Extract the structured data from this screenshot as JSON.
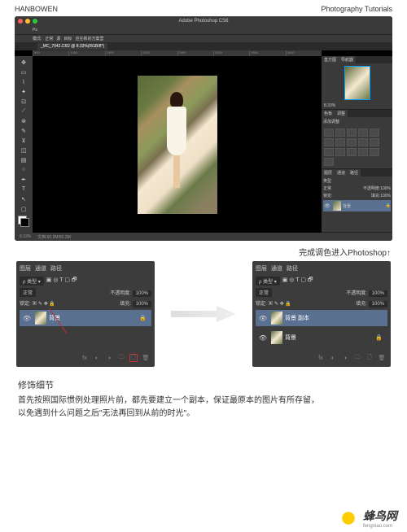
{
  "header": {
    "left": "HANBOWEN",
    "right": "Photography Tutorials"
  },
  "app": {
    "title": "Adobe Photoshop CS6"
  },
  "menubar": [
    "模式:",
    "正常",
    "源",
    "▼",
    "目标",
    "▼",
    "应在新的方案里",
    "☐"
  ],
  "tab": "_MC_7042.CR2 @ 8.33%(RGB/8*)",
  "ruler": [
    "500",
    "1000",
    "1500",
    "2000",
    "2500",
    "3000",
    "3500",
    "4000"
  ],
  "nav": {
    "tabs": [
      "直方图",
      "导航器"
    ],
    "zoom": "8.33%"
  },
  "adj": {
    "tabs": [
      "色板",
      "调整"
    ],
    "title": "添加调整"
  },
  "layers": {
    "tabs": [
      "图层",
      "通道",
      "路径"
    ],
    "kind": "类型",
    "blend": "正常",
    "opacity": "不透明度:",
    "opval": "100%",
    "lock": "锁定:",
    "fill": "填充:",
    "fillval": "100%",
    "layer": "背景"
  },
  "status": {
    "zoom": "8.33%",
    "doc": "文档:60.2M/60.2M"
  },
  "caption1": "完成调色进入Photoshop↑",
  "panelL": {
    "tabs": [
      "图层",
      "通道",
      "路径"
    ],
    "kind": "类型",
    "blend": "正常",
    "opacity": "不透明度:",
    "opval": "100%",
    "lock": "锁定:",
    "fill": "填充:",
    "fillval": "100%",
    "layer": "背景"
  },
  "panelR": {
    "tabs": [
      "图层",
      "通道",
      "路径"
    ],
    "kind": "类型",
    "blend": "正常",
    "opacity": "不透明度:",
    "opval": "100%",
    "lock": "锁定:",
    "fill": "填充:",
    "fillval": "100%",
    "layer1": "背景 副本",
    "layer2": "背景"
  },
  "text": {
    "title": "修饰细节",
    "body1": "首先按照国际惯例处理照片前，都先要建立一个副本，保证最原本的图片有所存留，",
    "body2": "以免遇到什么问题之后\"无法再回到从前的时光\"。"
  },
  "logo": {
    "cn": "蜂鸟网",
    "en": "fengniao.com"
  }
}
